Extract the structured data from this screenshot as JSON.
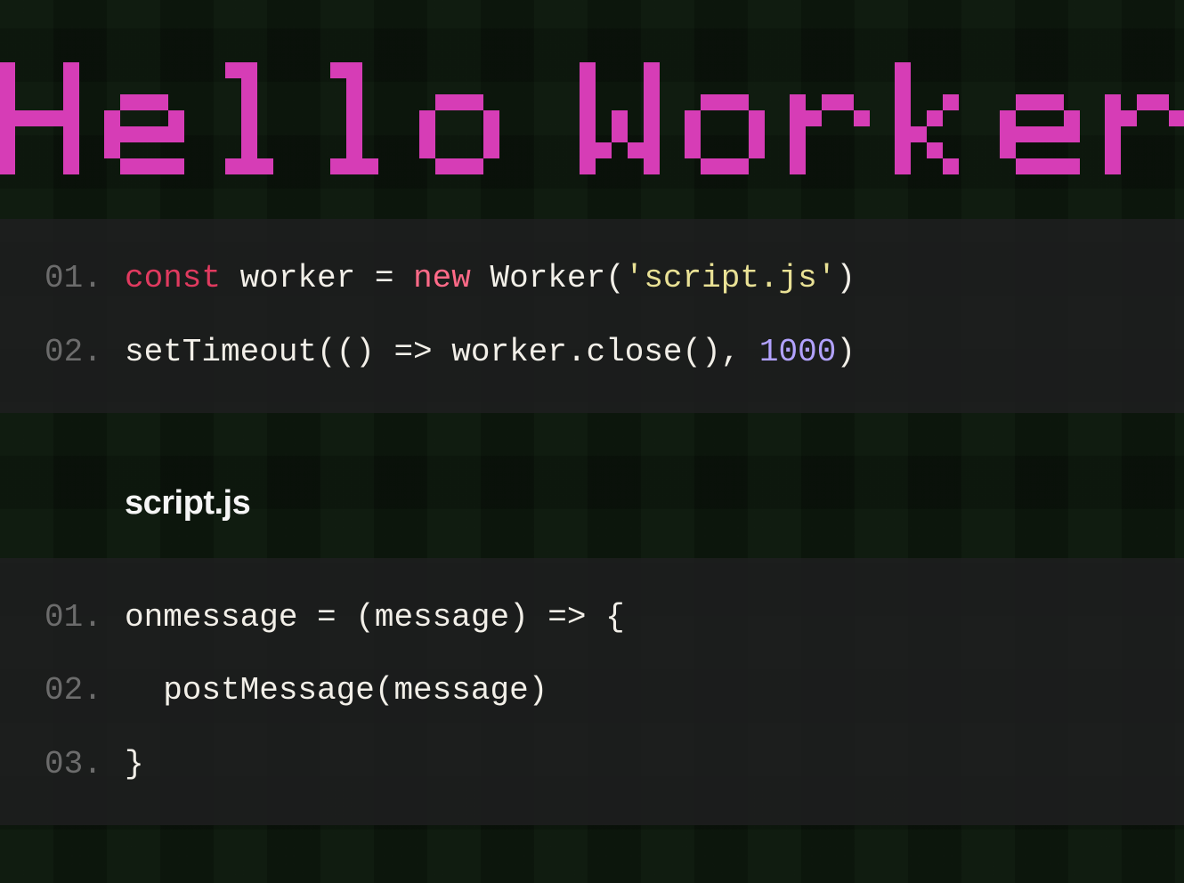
{
  "title": "Hello Worker",
  "subhead": "script.js",
  "block1": {
    "lines": [
      {
        "n": "01.",
        "tokens": [
          {
            "t": "const ",
            "c": "kw"
          },
          {
            "t": "worker = "
          },
          {
            "t": "new ",
            "c": "kw2"
          },
          {
            "t": "Worker("
          },
          {
            "t": "'script.js'",
            "c": "str"
          },
          {
            "t": ")"
          }
        ]
      },
      {
        "n": "02.",
        "tokens": [
          {
            "t": "setTimeout(() => worker.close(), "
          },
          {
            "t": "1000",
            "c": "num"
          },
          {
            "t": ")"
          }
        ]
      }
    ]
  },
  "block2": {
    "lines": [
      {
        "n": "01.",
        "tokens": [
          {
            "t": "onmessage = (message) => {"
          }
        ]
      },
      {
        "n": "02.",
        "tokens": [
          {
            "t": "  postMessage(message)"
          }
        ]
      },
      {
        "n": "03.",
        "tokens": [
          {
            "t": "}"
          }
        ]
      }
    ]
  }
}
